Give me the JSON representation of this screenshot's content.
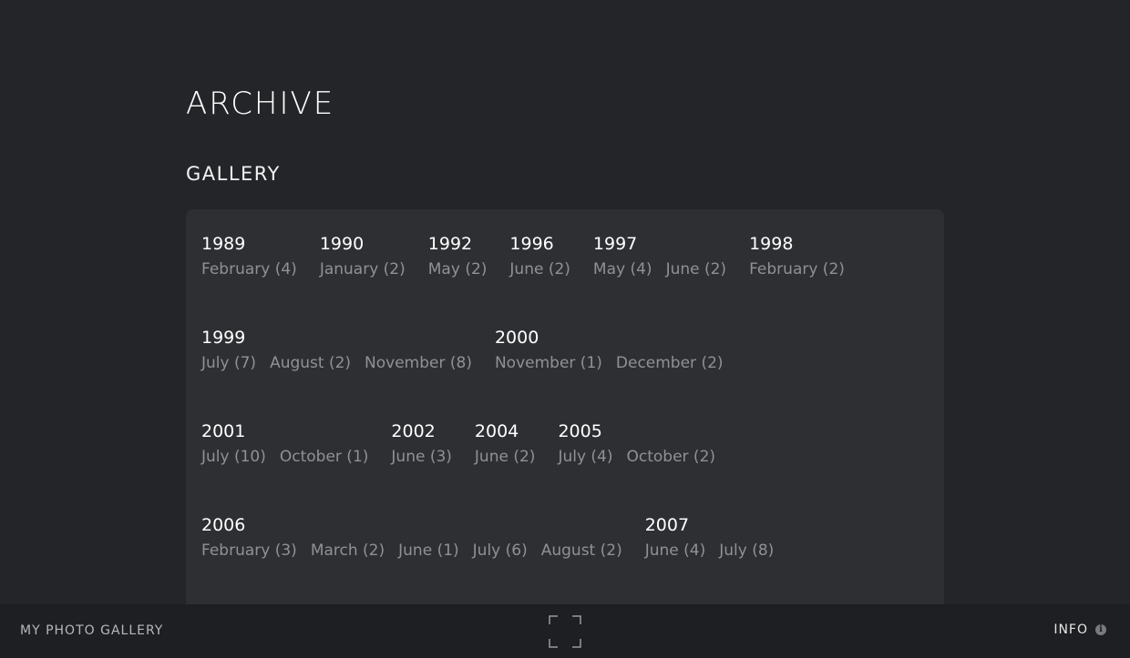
{
  "page": {
    "title": "ARCHIVE",
    "section_title": "GALLERY"
  },
  "archive": {
    "rows": [
      [
        {
          "year": "1989",
          "months": [
            "February (4)"
          ]
        },
        {
          "year": "1990",
          "months": [
            "January (2)"
          ]
        },
        {
          "year": "1992",
          "months": [
            "May (2)"
          ]
        },
        {
          "year": "1996",
          "months": [
            "June (2)"
          ]
        },
        {
          "year": "1997",
          "months": [
            "May (4)",
            "June (2)"
          ]
        },
        {
          "year": "1998",
          "months": [
            "February (2)"
          ]
        }
      ],
      [
        {
          "year": "1999",
          "months": [
            "July (7)",
            "August (2)",
            "November (8)"
          ]
        },
        {
          "year": "2000",
          "months": [
            "November (1)",
            "December (2)"
          ]
        }
      ],
      [
        {
          "year": "2001",
          "months": [
            "July (10)",
            "October (1)"
          ]
        },
        {
          "year": "2002",
          "months": [
            "June (3)"
          ]
        },
        {
          "year": "2004",
          "months": [
            "June (2)"
          ]
        },
        {
          "year": "2005",
          "months": [
            "July (4)",
            "October (2)"
          ]
        }
      ],
      [
        {
          "year": "2006",
          "months": [
            "February (3)",
            "March (2)",
            "June (1)",
            "July (6)",
            "August (2)"
          ]
        },
        {
          "year": "2007",
          "months": [
            "June (4)",
            "July (8)"
          ]
        }
      ]
    ]
  },
  "footer": {
    "site_name": "MY PHOTO GALLERY",
    "fullscreen_icon": "fullscreen-icon",
    "info_label": "INFO",
    "info_icon": "info-icon"
  },
  "colors": {
    "background": "#242528",
    "panel": "#2e2f33",
    "footer": "#1e1f22",
    "year_text": "#ffffff",
    "month_text": "#8f9196"
  }
}
